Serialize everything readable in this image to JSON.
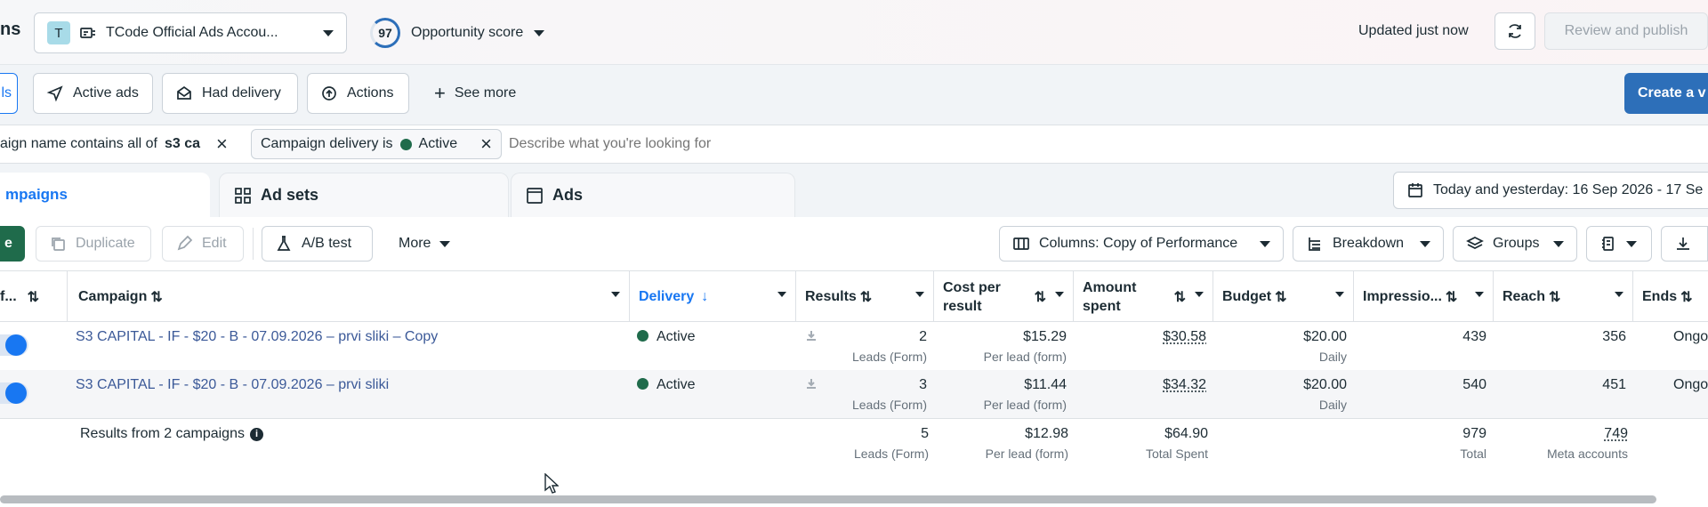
{
  "header": {
    "title_fragment": "ns",
    "account_initial": "T",
    "account_name": "TCode Official Ads Accou...",
    "score": "97",
    "score_label": "Opportunity score",
    "updated": "Updated just now",
    "review_publish": "Review and publish"
  },
  "nav": {
    "all_fragment": "ls",
    "active_ads": "Active ads",
    "had_delivery": "Had delivery",
    "actions": "Actions",
    "see_more": "See more",
    "create_fragment": "Create a v"
  },
  "filters": {
    "filter1_label": "aign name contains all of",
    "filter1_value": "s3 ca",
    "filter2_label": "Campaign delivery is",
    "filter2_value": "Active",
    "search_placeholder": "Describe what you're looking for"
  },
  "tabs": {
    "campaigns_fragment": "mpaigns",
    "ad_sets": "Ad sets",
    "ads": "Ads",
    "date_range": "Today and yesterday: 16 Sep 2026 - 17 Se"
  },
  "toolbar": {
    "create_fragment": "e",
    "duplicate": "Duplicate",
    "edit": "Edit",
    "ab_test": "A/B test",
    "more": "More",
    "columns": "Columns: Copy of Performance",
    "breakdown": "Breakdown",
    "groups": "Groups"
  },
  "table": {
    "headers": {
      "offon": "f...",
      "campaign": "Campaign",
      "delivery": "Delivery",
      "results": "Results",
      "cost_line1": "Cost per",
      "cost_line2": "result",
      "amount_line1": "Amount",
      "amount_line2": "spent",
      "budget": "Budget",
      "impressions": "Impressio...",
      "reach": "Reach",
      "ends": "Ends"
    },
    "rows": [
      {
        "name": "S3 CAPITAL - IF - $20 - B - 07.09.2026 – prvi sliki – Copy",
        "delivery": "Active",
        "results": "2",
        "results_sub": "Leads (Form)",
        "cost": "$15.29",
        "cost_sub": "Per lead (form)",
        "spent": "$30.58",
        "budget": "$20.00",
        "budget_sub": "Daily",
        "impressions": "439",
        "reach": "356",
        "ends": "Ongo"
      },
      {
        "name": "S3 CAPITAL - IF - $20 - B - 07.09.2026 – prvi sliki",
        "delivery": "Active",
        "results": "3",
        "results_sub": "Leads (Form)",
        "cost": "$11.44",
        "cost_sub": "Per lead (form)",
        "spent": "$34.32",
        "budget": "$20.00",
        "budget_sub": "Daily",
        "impressions": "540",
        "reach": "451",
        "ends": "Ongo"
      }
    ],
    "summary": {
      "label": "Results from 2 campaigns",
      "results": "5",
      "results_sub": "Leads (Form)",
      "cost": "$12.98",
      "cost_sub": "Per lead (form)",
      "spent": "$64.90",
      "spent_sub": "Total Spent",
      "impressions": "979",
      "impressions_sub": "Total",
      "reach": "749",
      "reach_sub": "Meta accounts"
    }
  },
  "colors": {
    "accent": "#1877f2",
    "active_dot": "#1f6b4b",
    "create_button": "#2d6fb9",
    "create_green": "#1f6b4b"
  }
}
